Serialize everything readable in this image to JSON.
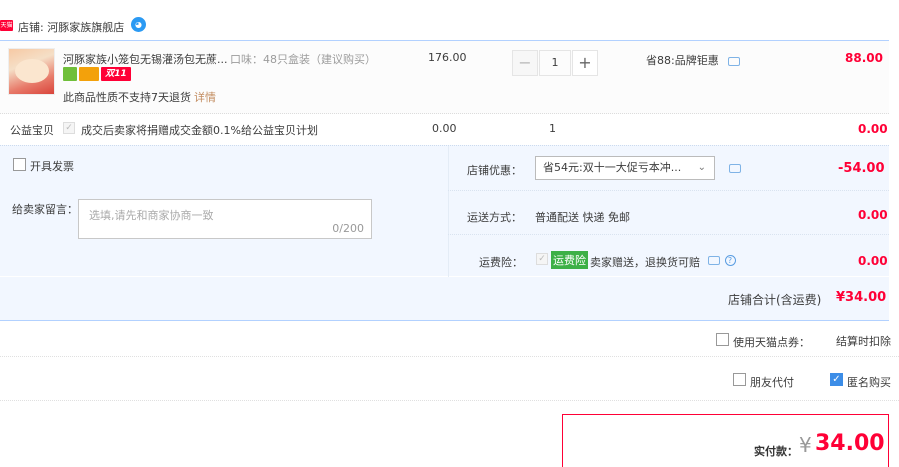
{
  "shop": {
    "badge": "天猫",
    "name": "店铺: 河豚家族旗舰店",
    "chat_icon": "wangwang-chat-icon"
  },
  "item": {
    "title": "河豚家族小笼包无锡灌汤包无蔗...",
    "sku": "口味：48只盒装（建议购买）",
    "badges": [
      "product-guarantee-icon",
      "card-icon",
      "双11"
    ],
    "no_return": "此商品性质不支持7天退货",
    "detail_link": "详情",
    "unit_price": "176.00",
    "quantity": "1",
    "minus": "−",
    "plus": "+",
    "discount": "省88:品牌钜惠",
    "total": "88.00"
  },
  "charity": {
    "label": "公益宝贝",
    "text": "成交后卖家将捐赠成交金额0.1%给公益宝贝计划",
    "price": "0.00",
    "qty": "1",
    "total": "0.00"
  },
  "options": {
    "invoice_label": "开具发票",
    "message_label": "给卖家留言：",
    "message_placeholder": "选填,请先和商家协商一致",
    "message_count": "0/200",
    "coupon_label": "店铺优惠：",
    "coupon_selected": "省54元:双十一大促亏本冲...",
    "coupon_amount": "-54.00",
    "shipping_label": "运送方式：",
    "shipping_method": "普通配送 快递 免邮",
    "shipping_amount": "0.00",
    "insurance_label": "运费险：",
    "insurance_tag": "运费险",
    "insurance_text": "卖家赠送，退换货可赔",
    "insurance_amount": "0.00"
  },
  "shop_total": {
    "label": "店铺合计(含运费)",
    "amount": "¥34.00"
  },
  "points": {
    "label": "使用天猫点券：",
    "note": "结算时扣除"
  },
  "friend_pay_label": "朋友代付",
  "anonymous_label": "匿名购买",
  "anonymous_checked": true,
  "payment": {
    "label": "实付款：",
    "currency": "¥",
    "amount": "34.00"
  },
  "colors": {
    "accent_red": "#ff0036",
    "panel_blue": "#f2f7ff",
    "border_blue": "#b2d1ff",
    "insurance_green": "#3db047"
  }
}
